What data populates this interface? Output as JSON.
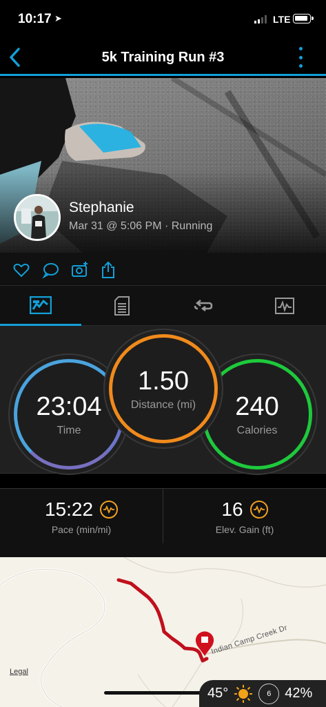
{
  "status_bar": {
    "time": "10:17",
    "network": "LTE"
  },
  "nav": {
    "title": "5k Training Run #3"
  },
  "hero": {
    "user_name": "Stephanie",
    "meta": "Mar 31 @ 5:06 PM · Running"
  },
  "tabs": [
    {
      "icon": "stats-chart-icon",
      "active": true
    },
    {
      "icon": "details-document-icon",
      "active": false
    },
    {
      "icon": "laps-loop-icon",
      "active": false
    },
    {
      "icon": "graph-icon",
      "active": false
    }
  ],
  "stats": {
    "time": {
      "value": "23:04",
      "label": "Time"
    },
    "distance": {
      "value": "1.50",
      "label": "Distance (mi)"
    },
    "calories": {
      "value": "240",
      "label": "Calories"
    }
  },
  "metrics": {
    "pace": {
      "value": "15:22",
      "label": "Pace (min/mi)"
    },
    "elev": {
      "value": "16",
      "label": "Elev. Gain (ft)"
    }
  },
  "map": {
    "legal": "Legal",
    "road": "Indian Camp Creek Dr"
  },
  "weather": {
    "temp": "45°",
    "wind": "6",
    "humidity": "42%"
  },
  "colors": {
    "accent": "#12a0d8",
    "time_ring": "#6b75c8",
    "distance_ring": "#f08a1c",
    "calories_ring": "#1ec93c",
    "route": "#c0101c"
  }
}
